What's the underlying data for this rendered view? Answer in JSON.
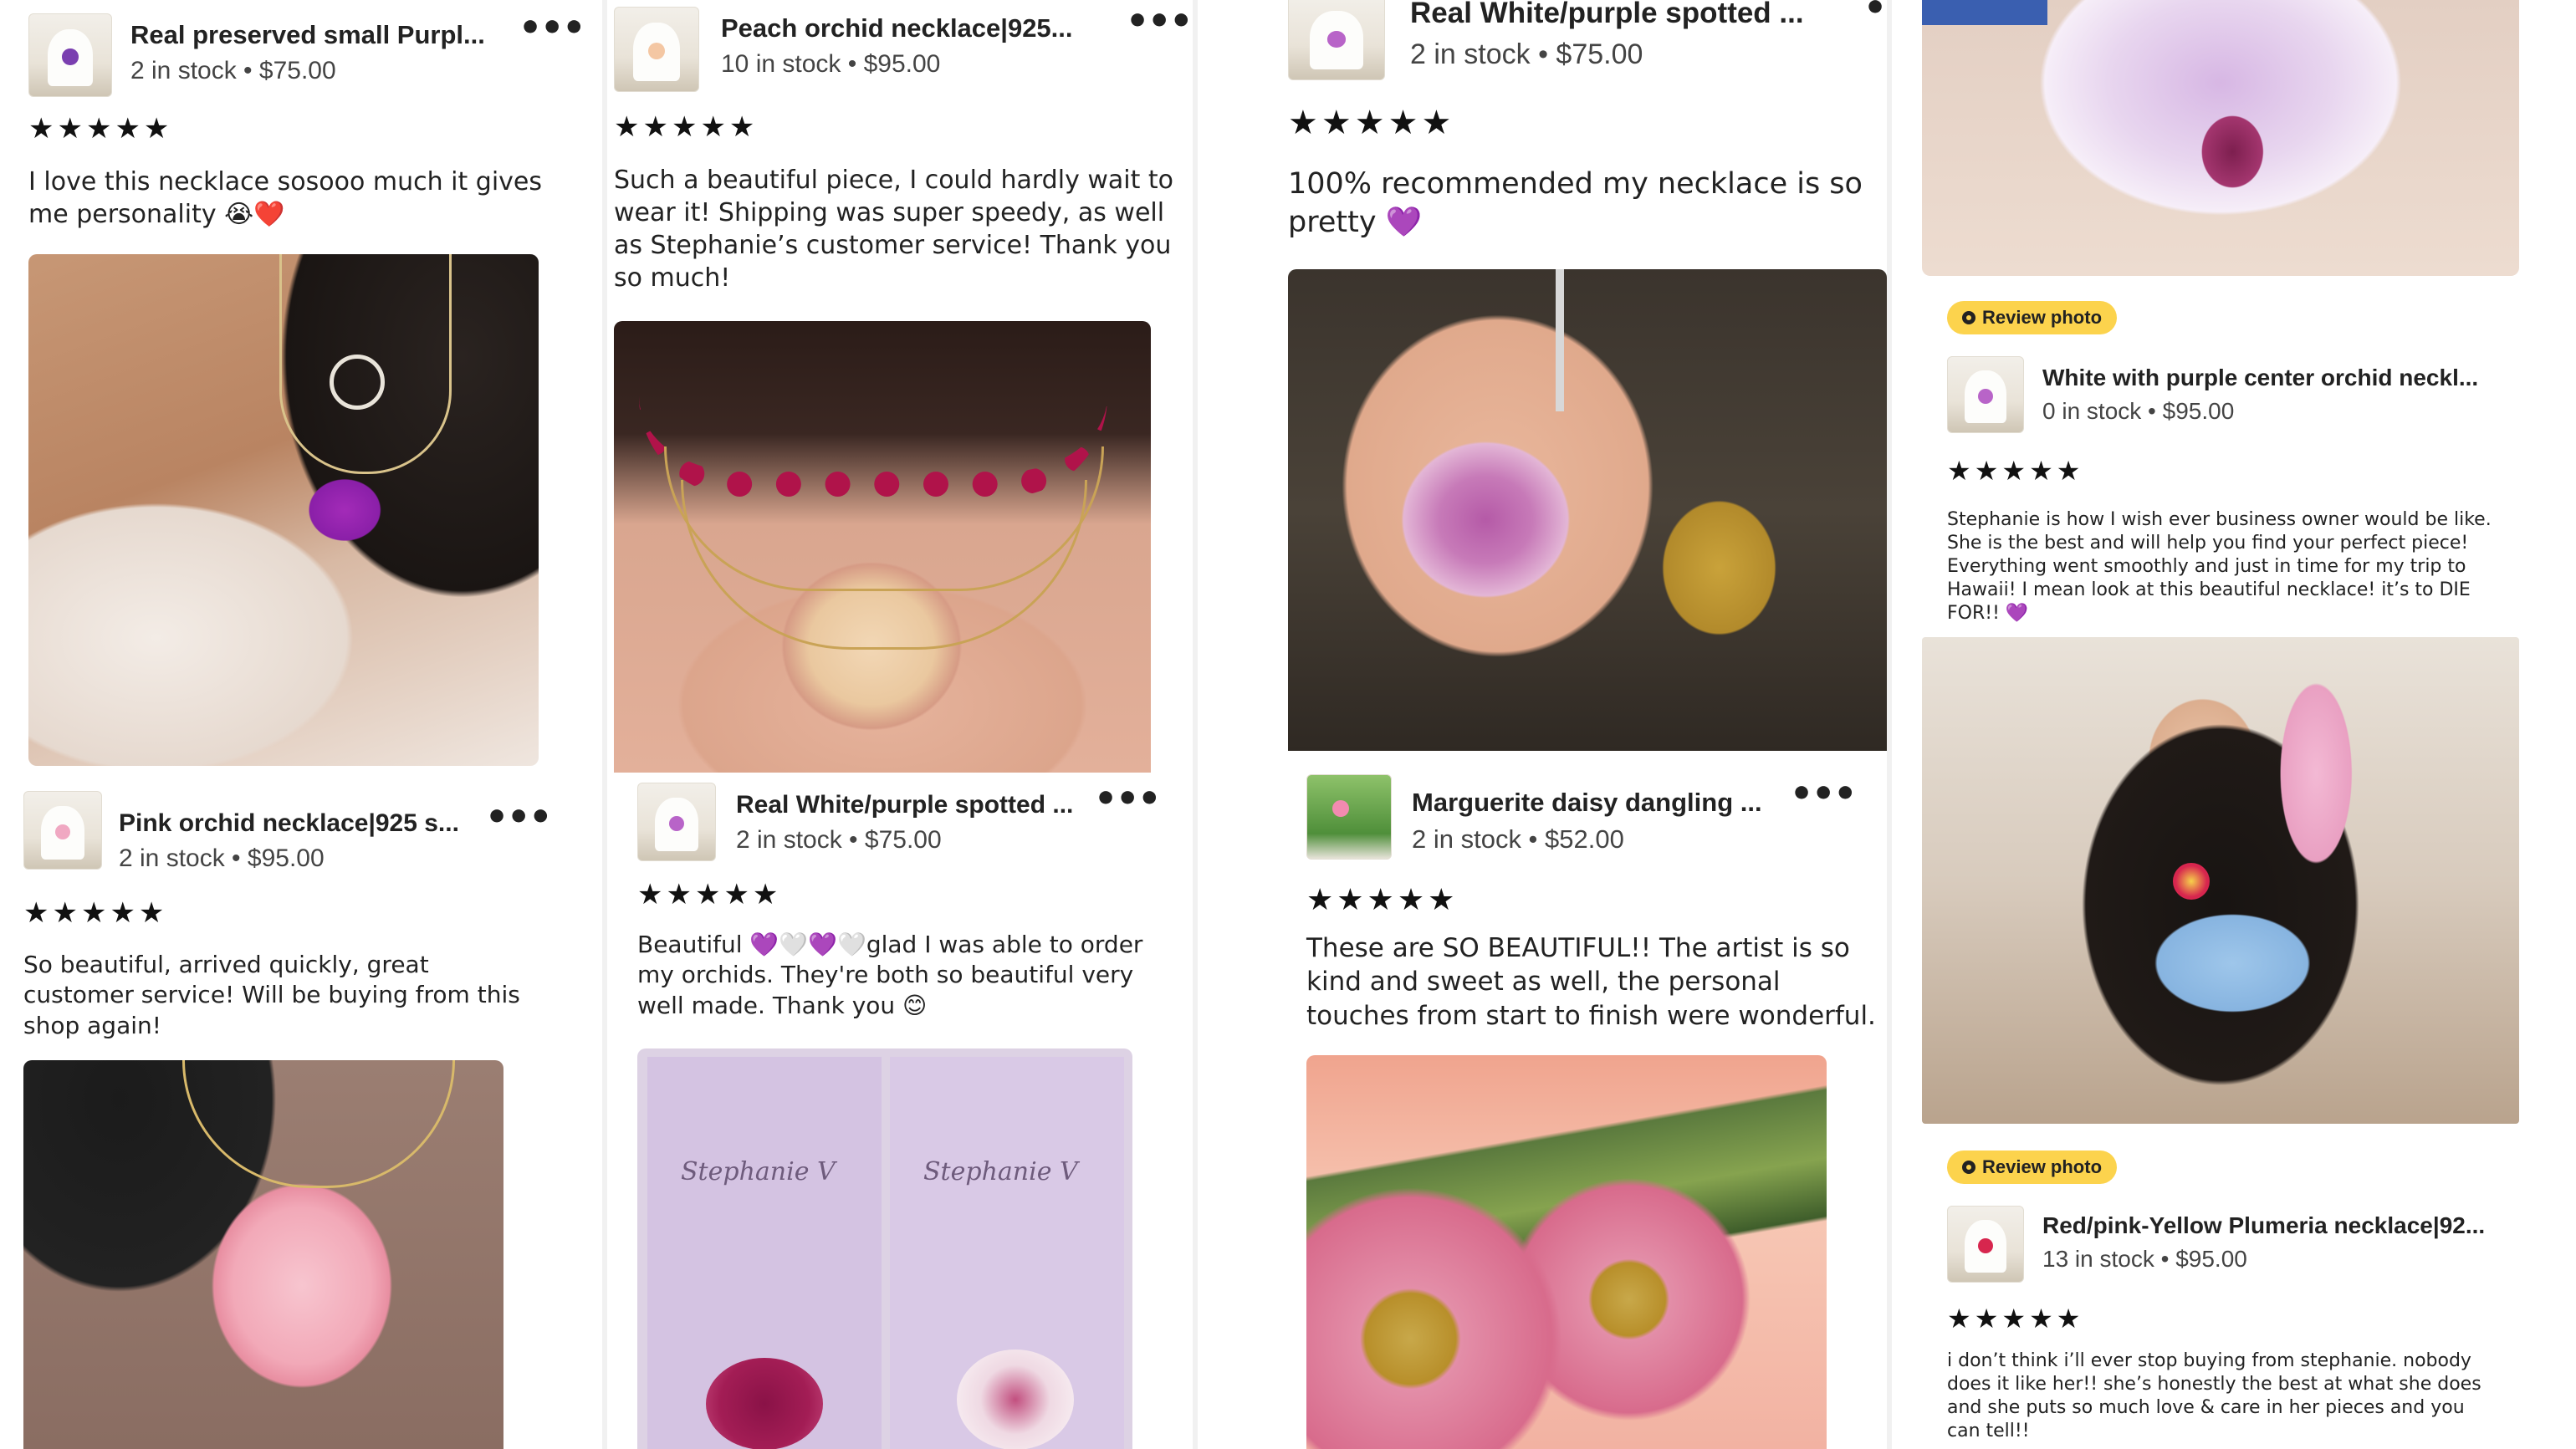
{
  "colors": {
    "accent_badge": "#fcd34d",
    "text": "#222222",
    "stars": "#111111",
    "purple_heart": "#8b3fd6"
  },
  "columns": [
    {
      "cards": [
        {
          "title": "Real preserved small Purpl...",
          "stock": "2 in stock • $75.00",
          "stars": "★★★★★",
          "review": "I love this necklace sosooo much it gives me personality 😭❤️"
        },
        {
          "title": "Pink orchid necklace|925 s...",
          "stock": "2 in stock • $95.00",
          "stars": "★★★★★",
          "review": "So beautiful, arrived quickly, great customer service! Will be buying from this shop again!"
        }
      ]
    },
    {
      "cards": [
        {
          "title": "Peach orchid necklace|925...",
          "stock": "10 in stock • $95.00",
          "stars": "★★★★★",
          "review": "Such a beautiful piece, I could hardly wait to wear it! Shipping was super speedy, as well as Stephanie’s customer service! Thank you so much!"
        },
        {
          "title": "Real White/purple spotted ...",
          "stock": "2 in stock • $75.00",
          "stars": "★★★★★",
          "review": "Beautiful 💜🤍💜🤍glad I was able to order my orchids. They're both so beautiful very well made. Thank you 😊",
          "box_brand": "Stephanie V"
        }
      ]
    },
    {
      "cards": [
        {
          "title": "Real White/purple spotted ...",
          "stock": "2 in stock • $75.00",
          "stars": "★★★★★",
          "review": "100% recommended my necklace is so pretty 💜"
        },
        {
          "title": "Marguerite daisy dangling ...",
          "stock": "2 in stock • $52.00",
          "stars": "★★★★★",
          "review": "These are SO BEAUTIFUL!! The artist is so kind and sweet as well, the personal touches from start to finish were wonderful."
        }
      ]
    },
    {
      "cards": [
        {
          "badge": "Review photo",
          "title": "White with purple center orchid neckl...",
          "stock": "0 in stock • $95.00",
          "stars": "★★★★★",
          "review": "Stephanie is how I wish ever business owner would be like. She is the best and will help you find your perfect piece! Everything went smoothly and just in time for my trip to Hawaii! I mean look at this beautiful necklace! it’s to DIE FOR!! 💜"
        },
        {
          "badge": "Review photo",
          "title": "Red/pink-Yellow Plumeria necklace|92...",
          "stock": "13 in stock • $95.00",
          "stars": "★★★★★",
          "review": "i don’t think i’ll ever stop buying from stephanie. nobody does it like her!! she’s honestly the best at what she does and she puts so much love & care in her pieces and you can tell!!"
        }
      ]
    }
  ]
}
